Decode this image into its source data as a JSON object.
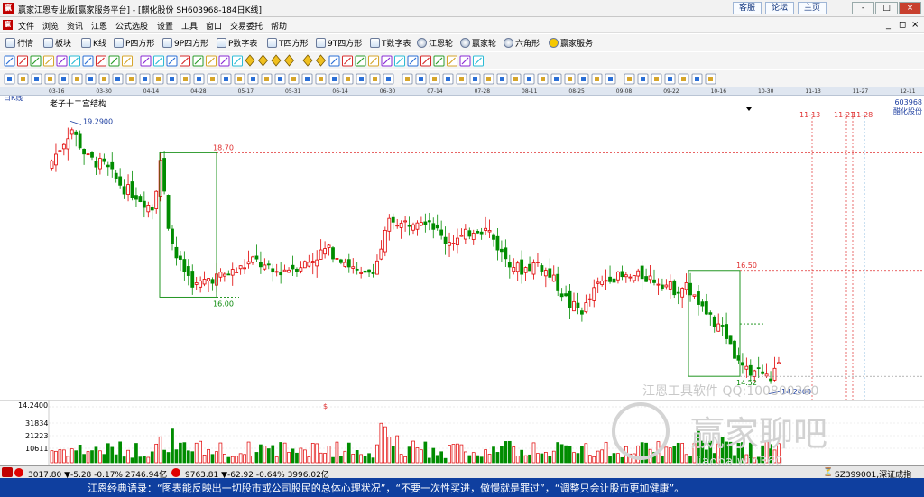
{
  "window": {
    "title": "赢家江恩专业版[赢家服务平台] - [麒化股份  SH603968-184日K线]",
    "logo": "赢",
    "links": [
      "客服",
      "论坛",
      "主页"
    ],
    "controls": [
      "-",
      "□",
      "×"
    ]
  },
  "menu": {
    "logo": "赢",
    "items": [
      "文件",
      "浏览",
      "资讯",
      "江恩",
      "公式选股",
      "设置",
      "工具",
      "窗口",
      "交易委托",
      "帮助"
    ],
    "win_controls": [
      "_",
      "◻",
      "×"
    ]
  },
  "toolbar1": [
    "行情",
    "板块",
    "K线",
    "P四方形",
    "9P四方形",
    "P数字表",
    "T四方形",
    "9T四方形",
    "T数字表",
    "江恩轮",
    "赢家轮",
    "六角形",
    "赢家服务"
  ],
  "date_axis": {
    "labels": [
      "03-16",
      "03-30",
      "04-14",
      "04-28",
      "05-17",
      "05-31",
      "06-14",
      "06-30",
      "07-14",
      "07-28",
      "08-11",
      "08-25",
      "09-08",
      "09-22",
      "10-16",
      "10-30",
      "11-13",
      "11-27",
      "12-11"
    ]
  },
  "chart": {
    "period_label": "日K线",
    "study_name": "老子十二宫结构",
    "stock_code": "603968",
    "stock_name": "醋化股份",
    "high_label": "19.2900",
    "low_label": "14.2400",
    "level_upper_1": "18.70",
    "level_lower_1": "16.00",
    "level_upper_2": "16.50",
    "level_lower_2": "14.52",
    "future_dates": [
      "11-13",
      "11-21",
      "11-28"
    ],
    "vol_top": "14.2400",
    "vol_ticks": [
      "31834",
      "21223",
      "10611"
    ],
    "dollar": "$",
    "watermark1": "江恩工具软件  QQ:100800360",
    "watermark2": "赢家聊吧",
    "watermark3": "liaoba.win360"
  },
  "status": {
    "index1": "3017.80  ▼-5.28  -0.17%  2746.94亿",
    "index2": "9763.81  ▼-62.92  -0.64%  3996.02亿",
    "index3": "SZ399001,深证成指"
  },
  "marquee": "江恩经典语录：“图表能反映出一切股市或公司股民的总体心理状况”，“不要一次性买进，傲慢就是罪过”，“调整只会让股市更加健康”。",
  "colors": {
    "up": "#e00000",
    "down": "#008c00",
    "box": "#0a8a0a",
    "blue": "#1e3fa0"
  }
}
